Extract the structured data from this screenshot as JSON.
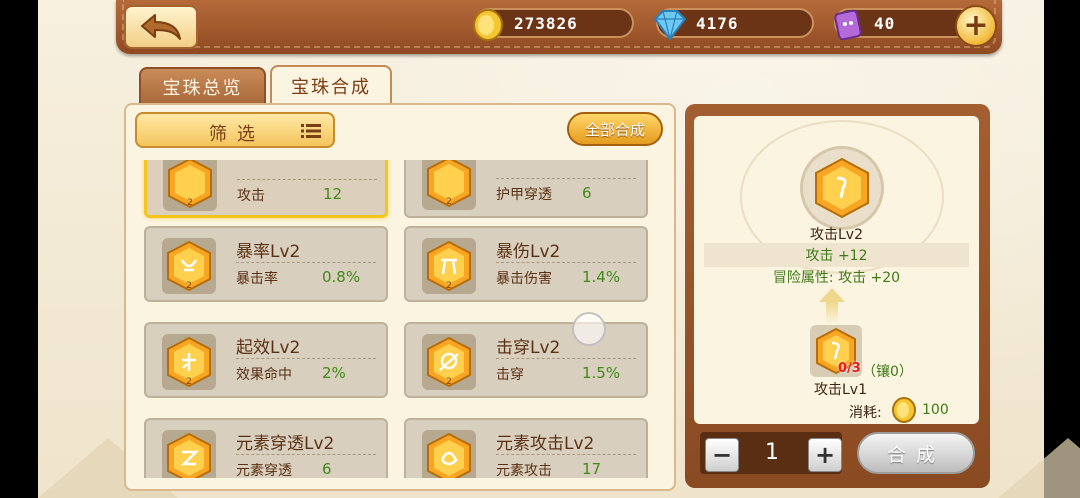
{
  "header": {
    "back_icon": "back-arrow-icon",
    "coins": "273826",
    "diamonds": "4176",
    "tickets": "40",
    "plus_icon": "plus-icon"
  },
  "tabs": [
    {
      "label": "宝珠总览",
      "active": false
    },
    {
      "label": "宝珠合成",
      "active": true
    }
  ],
  "filter": {
    "label": "筛选",
    "icon": "list-icon"
  },
  "combine_all_label": "全部合成",
  "gems": [
    {
      "name": "",
      "attr": "攻击",
      "value": "12",
      "level_badge": "2",
      "selected": true
    },
    {
      "name": "",
      "attr": "护甲穿透",
      "value": "6",
      "level_badge": "2",
      "selected": false
    },
    {
      "name": "暴率Lv2",
      "attr": "暴击率",
      "value": "0.8%",
      "level_badge": "2",
      "selected": false
    },
    {
      "name": "暴伤Lv2",
      "attr": "暴击伤害",
      "value": "1.4%",
      "level_badge": "2",
      "selected": false
    },
    {
      "name": "起效Lv2",
      "attr": "效果命中",
      "value": "2%",
      "level_badge": "2",
      "selected": false
    },
    {
      "name": "击穿Lv2",
      "attr": "击穿",
      "value": "1.5%",
      "level_badge": "2",
      "selected": false
    },
    {
      "name": "元素穿透Lv2",
      "attr": "元素穿透",
      "value": "6",
      "level_badge": "2",
      "selected": false
    },
    {
      "name": "元素攻击Lv2",
      "attr": "元素攻击",
      "value": "17",
      "level_badge": "2",
      "selected": false
    }
  ],
  "result": {
    "name": "攻击Lv2",
    "attr": "攻击 +12",
    "adventure": "冒险属性: 攻击 +20",
    "material_count": "0/3",
    "material_inlaid": "（镶0）",
    "material_name": "攻击Lv1",
    "cost_label": "消耗:",
    "cost_value": "100"
  },
  "quantity": {
    "minus": "−",
    "value": "1",
    "plus": "+"
  },
  "synth_label": "合成",
  "colors": {
    "accent": "#f4c55c",
    "frame": "#8f4a22",
    "positive": "#3f8a18"
  }
}
